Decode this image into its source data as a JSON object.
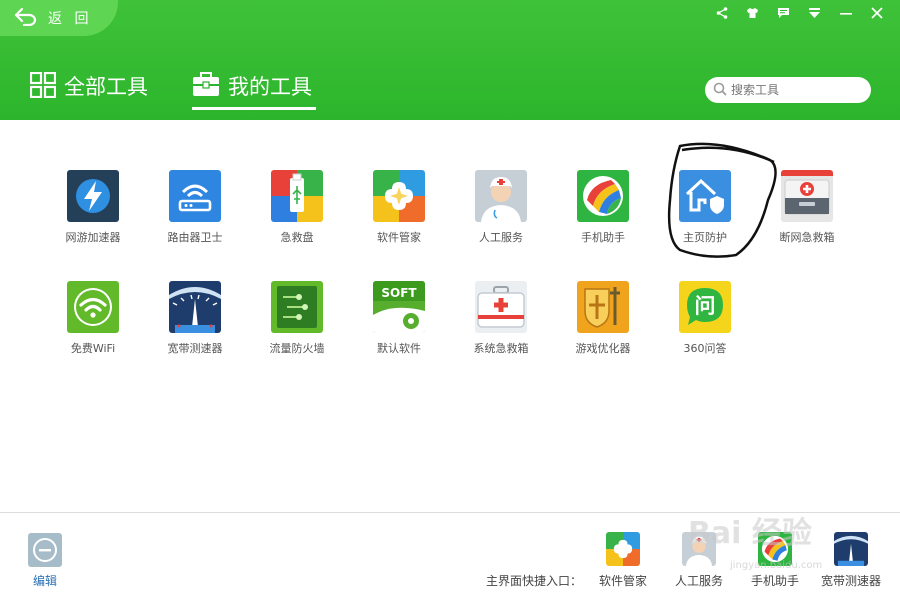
{
  "header": {
    "back_label": "返 回",
    "tabs": [
      {
        "label": "全部工具",
        "active": false
      },
      {
        "label": "我的工具",
        "active": true
      }
    ],
    "search_placeholder": "搜索工具",
    "window_controls": [
      "share-icon",
      "skin-icon",
      "message-icon",
      "menu-icon",
      "minimize-icon",
      "close-icon"
    ]
  },
  "tools": [
    {
      "label": "网游加速器",
      "icon": "lightning-icon"
    },
    {
      "label": "路由器卫士",
      "icon": "router-icon"
    },
    {
      "label": "急救盘",
      "icon": "usb-icon"
    },
    {
      "label": "软件管家",
      "icon": "software-manager-icon"
    },
    {
      "label": "人工服务",
      "icon": "doctor-icon"
    },
    {
      "label": "手机助手",
      "icon": "phone-assistant-icon"
    },
    {
      "label": "主页防护",
      "icon": "home-shield-icon"
    },
    {
      "label": "断网急救箱",
      "icon": "network-firstaid-icon"
    },
    {
      "label": "免费WiFi",
      "icon": "wifi-icon"
    },
    {
      "label": "宽带测速器",
      "icon": "speed-gauge-icon"
    },
    {
      "label": "流量防火墙",
      "icon": "firewall-icon"
    },
    {
      "label": "默认软件",
      "icon": "soft-icon",
      "badge": "SOFT"
    },
    {
      "label": "系统急救箱",
      "icon": "system-firstaid-icon"
    },
    {
      "label": "游戏优化器",
      "icon": "game-optimizer-icon"
    },
    {
      "label": "360问答",
      "icon": "qa-icon",
      "glyph": "问"
    }
  ],
  "footer": {
    "edit_label": "编辑",
    "shortcut_label": "主界面快捷入口：",
    "shortcuts": [
      {
        "label": "软件管家",
        "icon": "software-manager-icon"
      },
      {
        "label": "人工服务",
        "icon": "doctor-icon"
      },
      {
        "label": "手机助手",
        "icon": "phone-assistant-icon"
      },
      {
        "label": "宽带测速器",
        "icon": "speed-gauge-icon"
      }
    ]
  },
  "watermark": {
    "text": "Bai 经验",
    "sub": "jingyan.baidu.com"
  },
  "colors": {
    "header_green": "#2cb52c",
    "back_tab": "#5ed553",
    "link_blue": "#2b6fb3"
  }
}
